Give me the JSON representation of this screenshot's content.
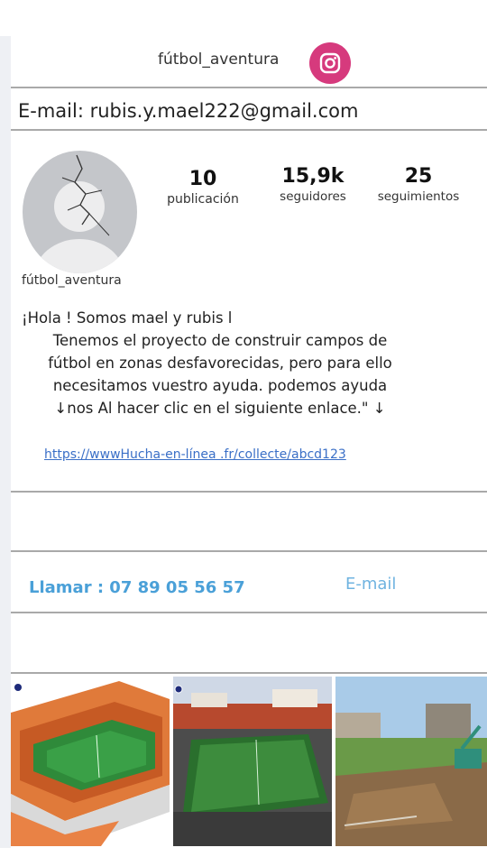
{
  "header": {
    "username": "fútbol_aventura",
    "instagram_icon": "instagram-icon",
    "instagram_color": "#d63a7d"
  },
  "email_row": {
    "text": "E-mail:  rubis.y.mael222@gmail.com"
  },
  "profile": {
    "avatar_icon": "default-avatar-icon",
    "username": "fútbol_aventura",
    "stats": [
      {
        "value": "10",
        "label": "publicación"
      },
      {
        "value": "15,9k",
        "label": "seguidores"
      },
      {
        "value": "25",
        "label": "seguimientos"
      }
    ]
  },
  "bio": {
    "lines": [
      "¡Hola ! Somos mael y rubis l",
      "Tenemos el proyecto de construir campos de",
      "fútbol en zonas desfavorecidas, pero para ello",
      "necesitamos vuestro ayuda. podemos ayuda",
      "↓nos Al hacer clic en el siguiente enlace.\" ↓"
    ],
    "link": "https://wwwHucha-en-línea .fr/collecte/abcd123"
  },
  "contact": {
    "call_label": "Llamar :  07 89 05 56 57",
    "email_label": "E-mail",
    "call_color": "#4aa0d8"
  },
  "posts": [
    {
      "name": "stadium-render"
    },
    {
      "name": "futsal-court-match"
    },
    {
      "name": "field-construction-site"
    }
  ]
}
